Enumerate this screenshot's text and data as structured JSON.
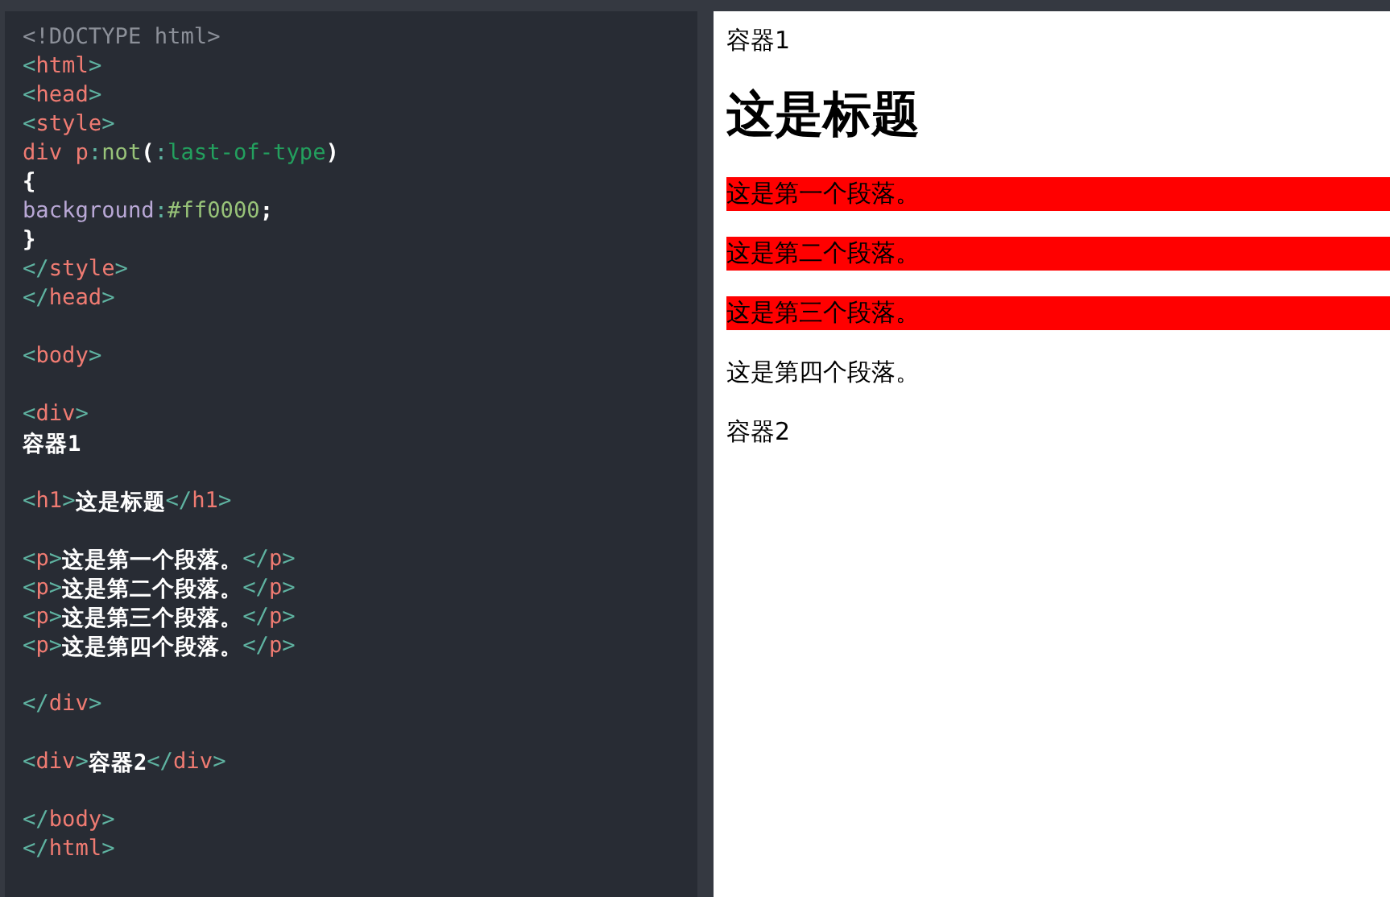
{
  "editor": {
    "lines": [
      {
        "kind": "code",
        "tokens": [
          {
            "kind": "doctype",
            "text": "<!DOCTYPE html>"
          }
        ]
      },
      {
        "kind": "code",
        "tokens": [
          {
            "kind": "bracket",
            "text": "<"
          },
          {
            "kind": "tag",
            "text": "html"
          },
          {
            "kind": "bracket",
            "text": ">"
          }
        ]
      },
      {
        "kind": "code",
        "tokens": [
          {
            "kind": "bracket",
            "text": "<"
          },
          {
            "kind": "tag",
            "text": "head"
          },
          {
            "kind": "bracket",
            "text": ">"
          }
        ]
      },
      {
        "kind": "code",
        "tokens": [
          {
            "kind": "bracket",
            "text": "<"
          },
          {
            "kind": "tag",
            "text": "style"
          },
          {
            "kind": "bracket",
            "text": ">"
          }
        ]
      },
      {
        "kind": "code",
        "tokens": [
          {
            "kind": "tag",
            "text": "div p"
          },
          {
            "kind": "bracket",
            "text": ":"
          },
          {
            "kind": "pseudo",
            "text": "not"
          },
          {
            "kind": "plain",
            "text": "("
          },
          {
            "kind": "bracket",
            "text": ":"
          },
          {
            "kind": "pseudo-arg",
            "text": "last-of-type"
          },
          {
            "kind": "plain",
            "text": ")"
          }
        ]
      },
      {
        "kind": "code",
        "tokens": [
          {
            "kind": "plain",
            "text": "{"
          }
        ]
      },
      {
        "kind": "code",
        "tokens": [
          {
            "kind": "property",
            "text": "background"
          },
          {
            "kind": "bracket",
            "text": ":"
          },
          {
            "kind": "value",
            "text": "#ff0000"
          },
          {
            "kind": "plain",
            "text": ";"
          }
        ]
      },
      {
        "kind": "code",
        "tokens": [
          {
            "kind": "plain",
            "text": "}"
          }
        ]
      },
      {
        "kind": "code",
        "tokens": [
          {
            "kind": "bracket",
            "text": "</"
          },
          {
            "kind": "tag",
            "text": "style"
          },
          {
            "kind": "bracket",
            "text": ">"
          }
        ]
      },
      {
        "kind": "code",
        "tokens": [
          {
            "kind": "bracket",
            "text": "</"
          },
          {
            "kind": "tag",
            "text": "head"
          },
          {
            "kind": "bracket",
            "text": ">"
          }
        ]
      },
      {
        "kind": "blank"
      },
      {
        "kind": "code",
        "tokens": [
          {
            "kind": "bracket",
            "text": "<"
          },
          {
            "kind": "tag",
            "text": "body"
          },
          {
            "kind": "bracket",
            "text": ">"
          }
        ]
      },
      {
        "kind": "blank"
      },
      {
        "kind": "code",
        "tokens": [
          {
            "kind": "bracket",
            "text": "<"
          },
          {
            "kind": "tag",
            "text": "div"
          },
          {
            "kind": "bracket",
            "text": ">"
          }
        ]
      },
      {
        "kind": "code",
        "tokens": [
          {
            "kind": "plain",
            "text": "容器1"
          }
        ]
      },
      {
        "kind": "blank"
      },
      {
        "kind": "code",
        "tokens": [
          {
            "kind": "bracket",
            "text": "<"
          },
          {
            "kind": "tag",
            "text": "h1"
          },
          {
            "kind": "bracket",
            "text": ">"
          },
          {
            "kind": "plain",
            "text": "这是标题"
          },
          {
            "kind": "bracket",
            "text": "</"
          },
          {
            "kind": "tag",
            "text": "h1"
          },
          {
            "kind": "bracket",
            "text": ">"
          }
        ]
      },
      {
        "kind": "blank"
      },
      {
        "kind": "code",
        "tokens": [
          {
            "kind": "bracket",
            "text": "<"
          },
          {
            "kind": "tag",
            "text": "p"
          },
          {
            "kind": "bracket",
            "text": ">"
          },
          {
            "kind": "plain",
            "text": "这是第一个段落。"
          },
          {
            "kind": "bracket",
            "text": "</"
          },
          {
            "kind": "tag",
            "text": "p"
          },
          {
            "kind": "bracket",
            "text": ">"
          }
        ]
      },
      {
        "kind": "code",
        "tokens": [
          {
            "kind": "bracket",
            "text": "<"
          },
          {
            "kind": "tag",
            "text": "p"
          },
          {
            "kind": "bracket",
            "text": ">"
          },
          {
            "kind": "plain",
            "text": "这是第二个段落。"
          },
          {
            "kind": "bracket",
            "text": "</"
          },
          {
            "kind": "tag",
            "text": "p"
          },
          {
            "kind": "bracket",
            "text": ">"
          }
        ]
      },
      {
        "kind": "code",
        "tokens": [
          {
            "kind": "bracket",
            "text": "<"
          },
          {
            "kind": "tag",
            "text": "p"
          },
          {
            "kind": "bracket",
            "text": ">"
          },
          {
            "kind": "plain",
            "text": "这是第三个段落。"
          },
          {
            "kind": "bracket",
            "text": "</"
          },
          {
            "kind": "tag",
            "text": "p"
          },
          {
            "kind": "bracket",
            "text": ">"
          }
        ]
      },
      {
        "kind": "code",
        "tokens": [
          {
            "kind": "bracket",
            "text": "<"
          },
          {
            "kind": "tag",
            "text": "p"
          },
          {
            "kind": "bracket",
            "text": ">"
          },
          {
            "kind": "plain",
            "text": "这是第四个段落。"
          },
          {
            "kind": "bracket",
            "text": "</"
          },
          {
            "kind": "tag",
            "text": "p"
          },
          {
            "kind": "bracket",
            "text": ">"
          }
        ]
      },
      {
        "kind": "blank"
      },
      {
        "kind": "code",
        "tokens": [
          {
            "kind": "bracket",
            "text": "</"
          },
          {
            "kind": "tag",
            "text": "div"
          },
          {
            "kind": "bracket",
            "text": ">"
          }
        ]
      },
      {
        "kind": "blank"
      },
      {
        "kind": "code",
        "tokens": [
          {
            "kind": "bracket",
            "text": "<"
          },
          {
            "kind": "tag",
            "text": "div"
          },
          {
            "kind": "bracket",
            "text": ">"
          },
          {
            "kind": "plain",
            "text": "容器2"
          },
          {
            "kind": "bracket",
            "text": "</"
          },
          {
            "kind": "tag",
            "text": "div"
          },
          {
            "kind": "bracket",
            "text": ">"
          }
        ]
      },
      {
        "kind": "blank"
      },
      {
        "kind": "code",
        "tokens": [
          {
            "kind": "bracket",
            "text": "</"
          },
          {
            "kind": "tag",
            "text": "body"
          },
          {
            "kind": "bracket",
            "text": ">"
          }
        ]
      },
      {
        "kind": "code",
        "tokens": [
          {
            "kind": "bracket",
            "text": "</"
          },
          {
            "kind": "tag",
            "text": "html"
          },
          {
            "kind": "bracket",
            "text": ">"
          }
        ]
      }
    ]
  },
  "preview": {
    "blocks": [
      {
        "kind": "text",
        "text": "容器1"
      },
      {
        "kind": "heading",
        "text": "这是标题"
      },
      {
        "kind": "paragraph",
        "text": "这是第一个段落。",
        "highlighted": true
      },
      {
        "kind": "paragraph",
        "text": "这是第二个段落。",
        "highlighted": true
      },
      {
        "kind": "paragraph",
        "text": "这是第三个段落。",
        "highlighted": true
      },
      {
        "kind": "paragraph",
        "text": "这是第四个段落。",
        "highlighted": false
      },
      {
        "kind": "text",
        "text": "容器2"
      }
    ]
  }
}
